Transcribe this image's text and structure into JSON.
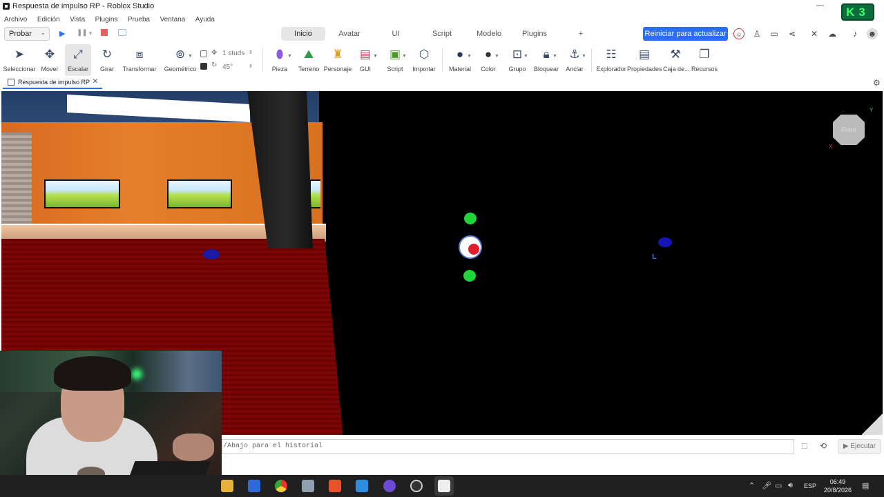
{
  "window": {
    "title": "Respuesta de impulso RP - Roblox Studio",
    "badge": "3"
  },
  "menu": [
    "Archivo",
    "Edición",
    "Vista",
    "Plugins",
    "Prueba",
    "Ventana",
    "Ayuda"
  ],
  "header": {
    "mode_select": "Probar",
    "tabs": [
      "Inicio",
      "Avatar",
      "UI",
      "Script",
      "Modelo",
      "Plugins"
    ],
    "active_tab": "Inicio",
    "add_tab": "+",
    "update_button": "Reiniciar para actualizar"
  },
  "toolbar": {
    "tools": [
      "Seleccionar",
      "Mover",
      "Escalar",
      "Girar",
      "Transformar",
      "Geométrico"
    ],
    "snap_move": "1 studs",
    "snap_rotate": "45°",
    "insert": [
      "Pieza",
      "Terreno",
      "Personaje",
      "GUI",
      "Script",
      "Importar"
    ],
    "edit": [
      "Material",
      "Color",
      "Grupo",
      "Bloquear",
      "Anclar"
    ],
    "panels": [
      "Explorador",
      "Propiedades",
      "Caja de...",
      "Recursos"
    ]
  },
  "document_tab": "Respuesta de impulso RP",
  "viewport": {
    "view_cube_label": "Front",
    "axis_y": "Y",
    "axis_x": "X",
    "marker": "L"
  },
  "command_bar": {
    "placeholder": "/Abajo para el historial",
    "run_button": "Ejecutar"
  },
  "taskbar": {
    "language": "ESP",
    "time": "06:49",
    "date": "20/8/2026"
  },
  "colors": {
    "accent": "#2b6ef6",
    "viewport_bg": "#000000",
    "taskbar_bg": "#202020"
  }
}
